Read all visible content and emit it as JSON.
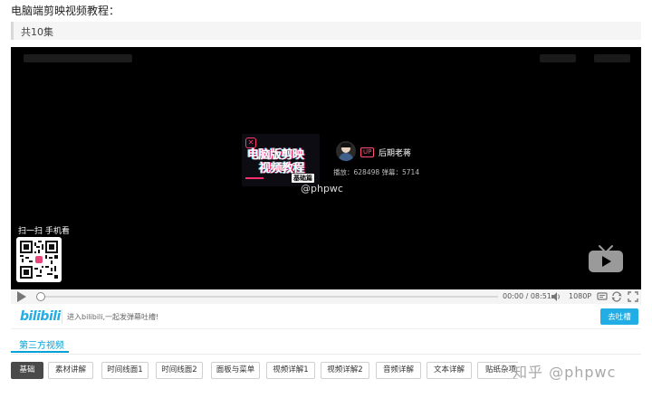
{
  "page": {
    "title": "电脑端剪映视频教程：",
    "episode_count": "共10集"
  },
  "player": {
    "cover": {
      "line1": "电脑版剪映",
      "line2": "视频教程",
      "badge": "基础篇"
    },
    "uploader": {
      "tag": "UP",
      "name": "后期老蒋",
      "stats": "播放：628498    弹幕：5714"
    },
    "watermark": "@phpwc",
    "qr": {
      "title": "扫一扫 手机看"
    },
    "controls": {
      "time": "00:00 / 08:51",
      "quality": "1080P"
    }
  },
  "danmaku": {
    "logo": "bilibili",
    "hint": "进入bilibili,一起发弹幕吐槽!",
    "send_label": "去吐槽"
  },
  "tabs": {
    "third_party": "第三方视频"
  },
  "episodes": [
    {
      "label": "基础",
      "active": true
    },
    {
      "label": "素材讲解",
      "active": false
    },
    {
      "label": "时间线面1",
      "active": false
    },
    {
      "label": "时间线面2",
      "active": false
    },
    {
      "label": "面板与菜单",
      "active": false
    },
    {
      "label": "视频详解1",
      "active": false
    },
    {
      "label": "视频详解2",
      "active": false
    },
    {
      "label": "音频详解",
      "active": false
    },
    {
      "label": "文本详解",
      "active": false
    },
    {
      "label": "贴纸杂项",
      "active": false
    }
  ],
  "site_watermark": "知乎 @phpwc",
  "colors": {
    "accent": "#00a1d6",
    "bili_blue": "#23ade5",
    "up_pink": "#ff4f7a"
  },
  "icons": {
    "play": "play-icon",
    "volume": "volume-icon",
    "tv": "tv-icon"
  }
}
